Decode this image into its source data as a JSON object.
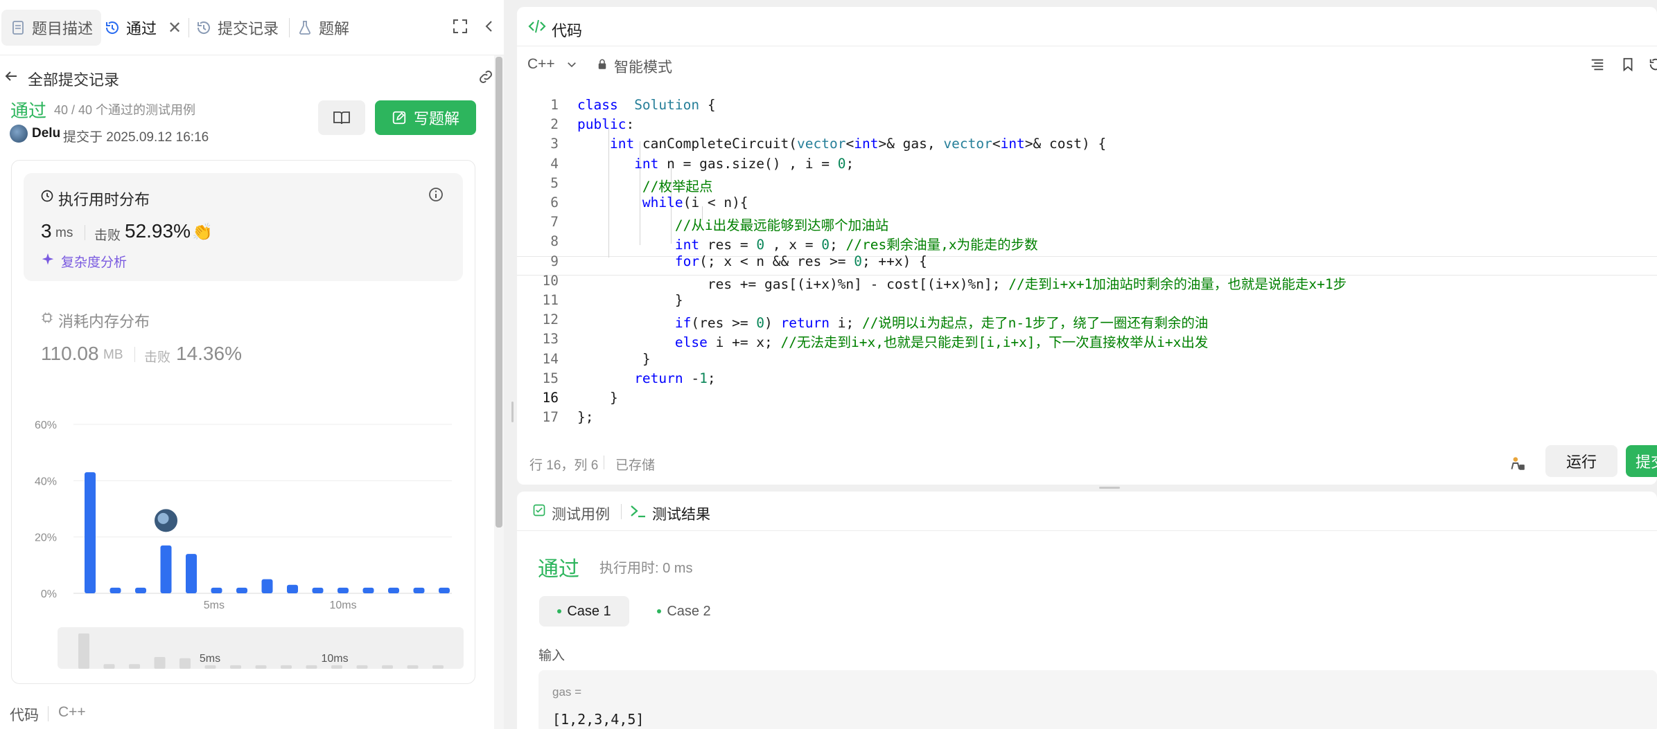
{
  "left_tabs": {
    "description": "题目描述",
    "accepted": "通过",
    "submissions": "提交记录",
    "solutions": "题解"
  },
  "subheader": {
    "all_submissions": "全部提交记录"
  },
  "result": {
    "status": "通过",
    "testcases": "40 / 40 个通过的测试用例",
    "user": "Delu",
    "submitted_at": "提交于 2025.09.12 16:16",
    "write_solution": "写题解"
  },
  "runtime": {
    "title": "执行用时分布",
    "value": "3",
    "unit": "ms",
    "beats_label": "击败",
    "beats": "52.93%",
    "complexity": "复杂度分析"
  },
  "memory": {
    "title": "消耗内存分布",
    "value": "110.08",
    "unit": "MB",
    "beats_label": "击败",
    "beats": "14.36%"
  },
  "chart_data": {
    "type": "bar",
    "y_ticks": [
      "60%",
      "40%",
      "20%",
      "0%"
    ],
    "ylim": [
      0,
      60
    ],
    "x_ticks": [
      "5ms",
      "10ms"
    ],
    "values": [
      43,
      2,
      2,
      17,
      14,
      2,
      2,
      5,
      3,
      2,
      2,
      2,
      2,
      2,
      2
    ],
    "highlight_index": 3,
    "bar_color": "#2f6ff0"
  },
  "mini_chart": {
    "x_ticks": [
      "5ms",
      "10ms"
    ],
    "values": [
      60,
      8,
      8,
      20,
      18,
      6,
      6,
      6,
      6,
      6,
      6,
      6,
      6,
      6,
      6
    ]
  },
  "bottom_left": {
    "code_label": "代码",
    "lang": "C++"
  },
  "code_panel": {
    "title": "代码",
    "language": "C++",
    "mode": "智能模式",
    "cursor": "行 16，列 6",
    "saved": "已存储",
    "run": "运行",
    "submit": "提交"
  },
  "code_lines": [
    [
      [
        "kw",
        "class"
      ],
      [
        "",
        "  "
      ],
      [
        "ty",
        "Solution"
      ],
      [
        "",
        " {"
      ]
    ],
    [
      [
        "kw",
        "public"
      ],
      [
        "",
        ":"
      ]
    ],
    [
      [
        "",
        "    "
      ],
      [
        "kw",
        "int"
      ],
      [
        "",
        " canCompleteCircuit("
      ],
      [
        "ty",
        "vector"
      ],
      [
        "",
        "<"
      ],
      [
        "kw",
        "int"
      ],
      [
        "",
        ">& gas, "
      ],
      [
        "ty",
        "vector"
      ],
      [
        "",
        "<"
      ],
      [
        "kw",
        "int"
      ],
      [
        "",
        ">& cost) {"
      ]
    ],
    [
      [
        "",
        "       "
      ],
      [
        "kw",
        "int"
      ],
      [
        "",
        " n = gas.size() , i = "
      ],
      [
        "nm",
        "0"
      ],
      [
        "",
        ";"
      ]
    ],
    [
      [
        "",
        "        "
      ],
      [
        "cm",
        "//枚举起点"
      ]
    ],
    [
      [
        "",
        "        "
      ],
      [
        "kw",
        "while"
      ],
      [
        "",
        "(i < n){"
      ]
    ],
    [
      [
        "",
        "            "
      ],
      [
        "cm",
        "//从i出发最远能够到达哪个加油站"
      ]
    ],
    [
      [
        "",
        "            "
      ],
      [
        "kw",
        "int"
      ],
      [
        "",
        " res = "
      ],
      [
        "nm",
        "0"
      ],
      [
        "",
        " , x = "
      ],
      [
        "nm",
        "0"
      ],
      [
        "",
        "; "
      ],
      [
        "cm",
        "//res剩余油量,x为能走的步数"
      ]
    ],
    [
      [
        "",
        "            "
      ],
      [
        "kw",
        "for"
      ],
      [
        "",
        "(; x < n && res >= "
      ],
      [
        "nm",
        "0"
      ],
      [
        "",
        "; ++x) {"
      ]
    ],
    [
      [
        "",
        "                res += gas[(i+x)%n] - cost[(i+x)%n]; "
      ],
      [
        "cm",
        "//走到i+x+1加油站时剩余的油量，也就是说能走x+1步"
      ]
    ],
    [
      [
        "",
        "            }"
      ]
    ],
    [
      [
        "",
        "            "
      ],
      [
        "kw",
        "if"
      ],
      [
        "",
        "(res >= "
      ],
      [
        "nm",
        "0"
      ],
      [
        "",
        ") "
      ],
      [
        "kw",
        "return"
      ],
      [
        "",
        " i; "
      ],
      [
        "cm",
        "//说明以i为起点，走了n-1步了，绕了一圈还有剩余的油"
      ]
    ],
    [
      [
        "",
        "            "
      ],
      [
        "kw",
        "else"
      ],
      [
        "",
        " i += x; "
      ],
      [
        "cm",
        "//无法走到i+x,也就是只能走到[i,i+x]，下一次直接枚举从i+x出发"
      ]
    ],
    [
      [
        "",
        "        }"
      ]
    ],
    [
      [
        "",
        "       "
      ],
      [
        "kw",
        "return"
      ],
      [
        "",
        " -"
      ],
      [
        "nm",
        "1"
      ],
      [
        "",
        ";"
      ]
    ],
    [
      [
        "",
        "    }"
      ]
    ],
    [
      [
        "",
        "};"
      ]
    ]
  ],
  "test_panel": {
    "tab_cases": "测试用例",
    "tab_results": "测试结果",
    "status": "通过",
    "exec_time": "执行用时: 0 ms",
    "case1": "Case 1",
    "case2": "Case 2",
    "input_label": "输入",
    "var_name": "gas =",
    "var_value": "[1,2,3,4,5]"
  },
  "colors": {
    "accent_green": "#2db55d",
    "bar_blue": "#2f6ff0"
  }
}
